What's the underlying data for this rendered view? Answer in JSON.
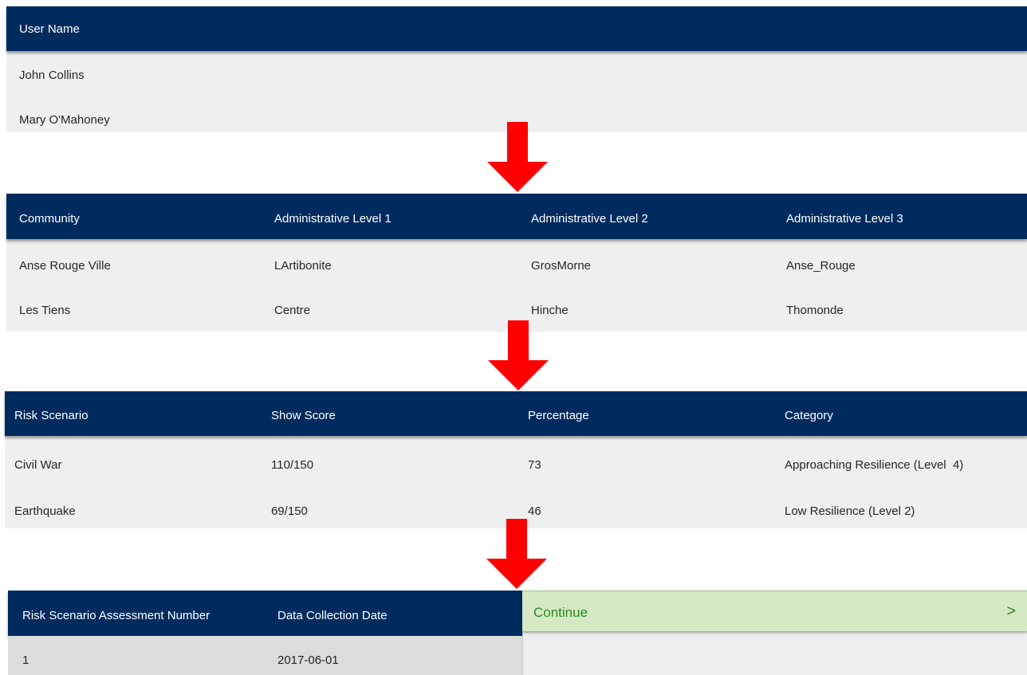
{
  "users": {
    "header": "User Name",
    "rows": [
      "John Collins",
      "Mary O'Mahoney"
    ]
  },
  "communities": {
    "headers": [
      "Community",
      "Administrative Level 1",
      "Administrative Level 2",
      "Administrative Level 3"
    ],
    "rows": [
      [
        "Anse Rouge Ville",
        "LArtibonite",
        "GrosMorne",
        "Anse_Rouge"
      ],
      [
        "Les Tiens",
        "Centre",
        "Hinche",
        "Thomonde"
      ]
    ]
  },
  "risk": {
    "headers": [
      "Risk Scenario",
      "Show Score",
      "Percentage",
      "Category"
    ],
    "rows": [
      [
        "Civil War",
        "110/150",
        "73",
        "Approaching Resilience (Level  4)"
      ],
      [
        "Earthquake",
        "69/150",
        "46",
        "Low Resilience (Level 2)"
      ]
    ]
  },
  "assessment": {
    "headers": [
      "Risk Scenario Assessment Number",
      "Data Collection Date"
    ],
    "rows": [
      [
        "1",
        "2017-06-01"
      ]
    ]
  },
  "continue": {
    "label": "Continue",
    "chevron": ">"
  },
  "colors": {
    "header_bg": "#002b5e",
    "row_bg": "#efefef",
    "arrow": "#ff0000",
    "continue_bg": "#d4e9c4",
    "continue_text": "#2f8a21"
  },
  "icons": {
    "arrow": "arrow-down-icon",
    "continue": "chevron-right-icon"
  }
}
